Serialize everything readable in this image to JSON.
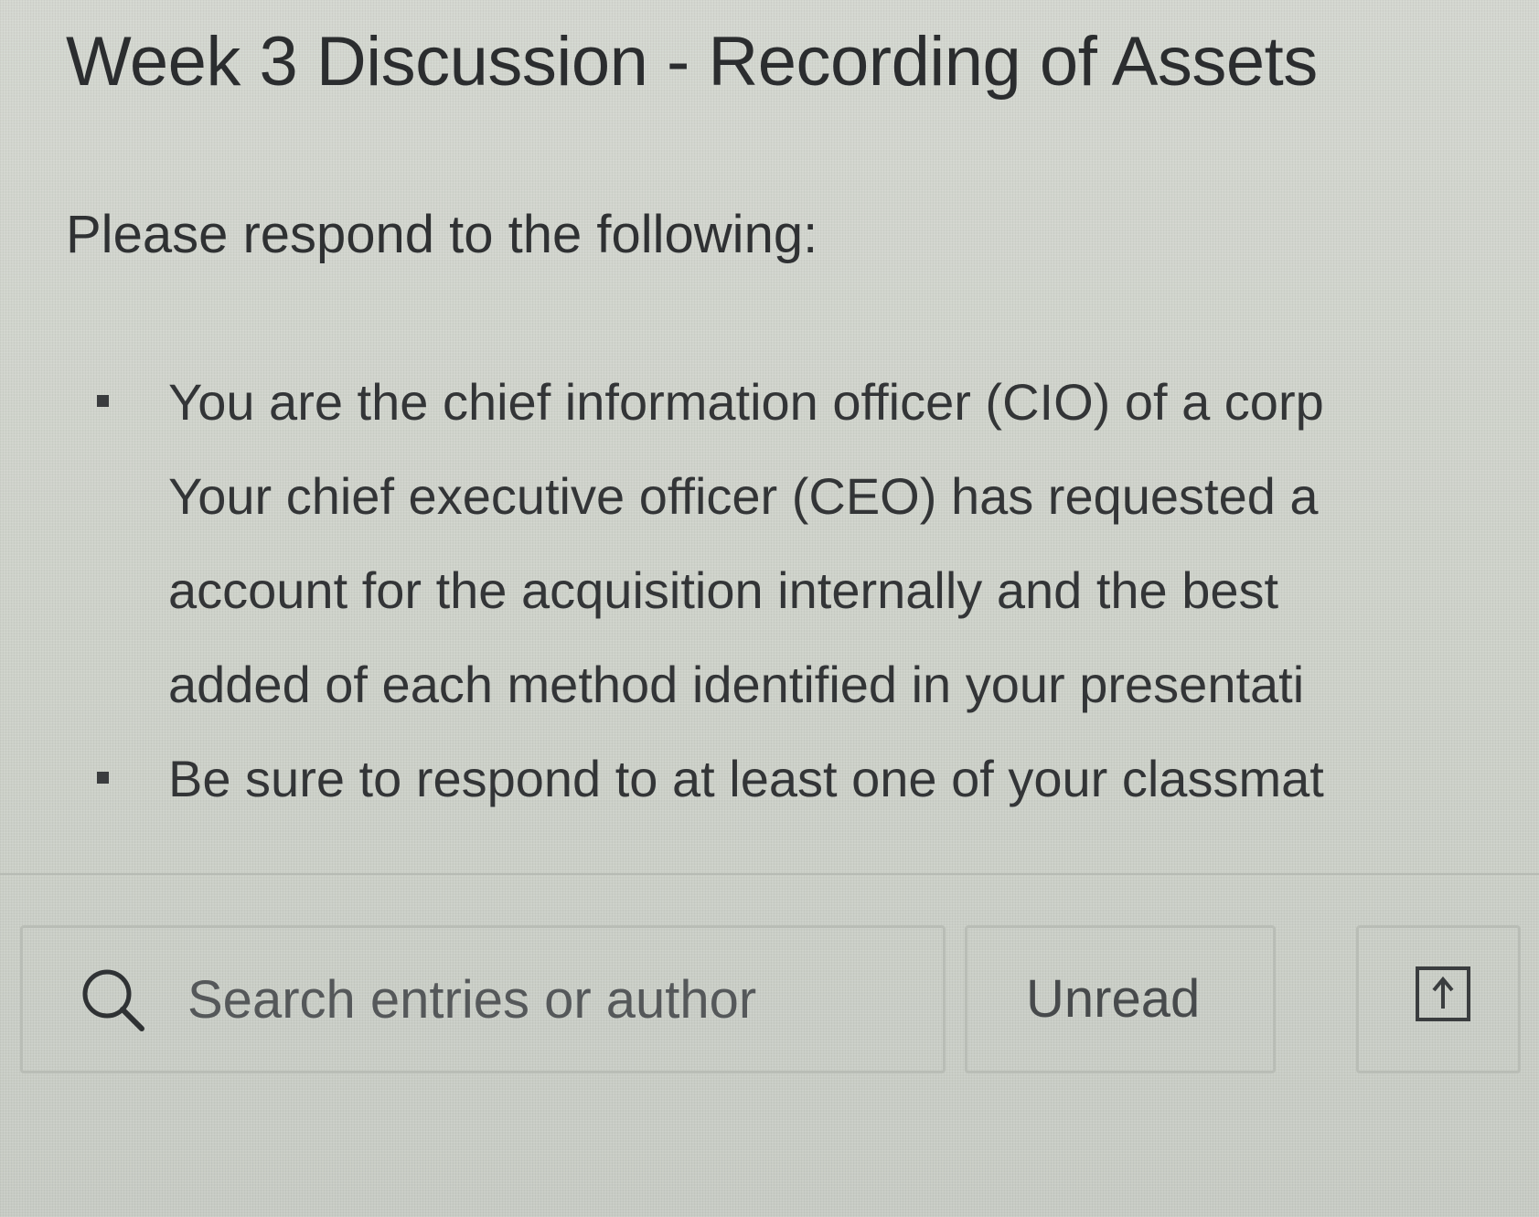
{
  "page": {
    "title": "Week 3 Discussion - Recording of Assets",
    "intro": "Please respond to the following:",
    "bullets": [
      {
        "lines": [
          "You are the chief information officer (CIO) of a corp",
          "Your chief executive officer (CEO) has requested a",
          "account for the acquisition internally and the best",
          "added of each method identified in your presentati"
        ]
      },
      {
        "lines": [
          "Be sure to respond to at least one of your classmat"
        ]
      }
    ]
  },
  "toolbar": {
    "search": {
      "icon": "search-icon",
      "placeholder": "Search entries or author",
      "value": ""
    },
    "filter": {
      "selected": "Unread"
    },
    "sort": {
      "icon": "sort-icon"
    }
  }
}
